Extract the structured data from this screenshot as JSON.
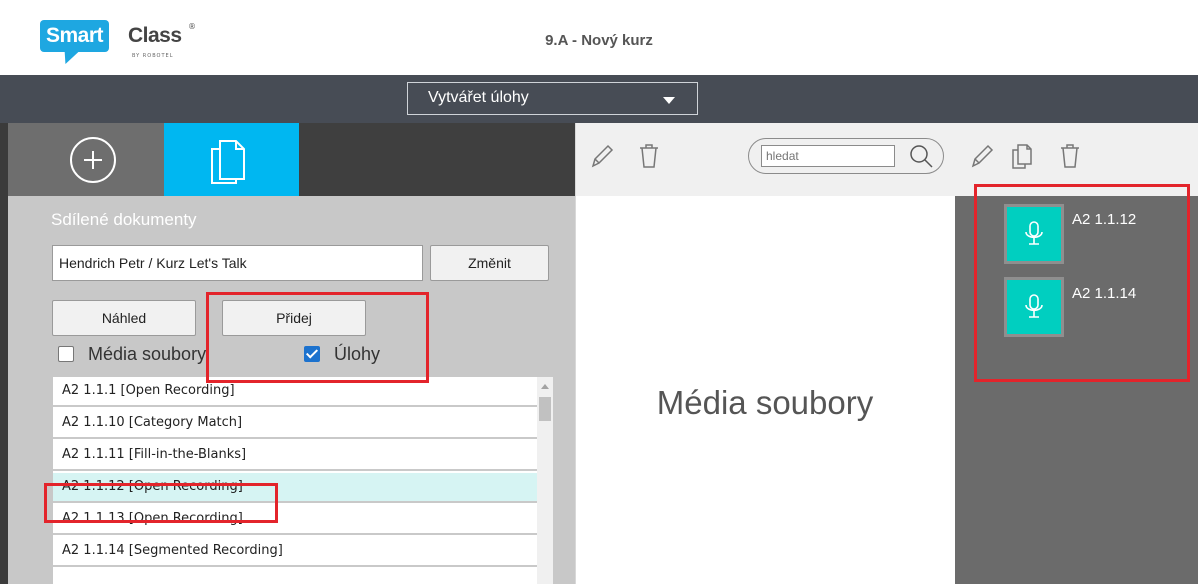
{
  "header": {
    "logo_smart": "Smart",
    "logo_class": "Class",
    "logo_reg": "®",
    "logo_by": "BY ROBOTEL",
    "course_title": "9.A - Nový kurz"
  },
  "mode_select": {
    "value": "Vytvářet úlohy"
  },
  "left_panel": {
    "title": "Sdílené dokumenty",
    "path_value": "Hendrich Petr / Kurz Let's Talk",
    "change_button": "Změnit",
    "preview_button": "Náhled",
    "add_button": "Přidej",
    "filters": [
      {
        "label": "Média soubory",
        "checked": false
      },
      {
        "label": "Úlohy",
        "checked": true
      }
    ],
    "items": [
      {
        "label": "A2 1.1.1 [Open Recording]"
      },
      {
        "label": "A2 1.1.10 [Category Match]"
      },
      {
        "label": "A2 1.1.11 [Fill-in-the-Blanks]"
      },
      {
        "label": "A2 1.1.12 [Open Recording]",
        "selected": true
      },
      {
        "label": "A2 1.1.13 [Open Recording]"
      },
      {
        "label": "A2 1.1.14 [Segmented Recording]"
      }
    ]
  },
  "middle_panel": {
    "empty_label": "Média soubory",
    "search_placeholder": "hledat"
  },
  "right_panel": {
    "tasks": [
      {
        "label": "A2 1.1.12",
        "icon": "microphone-icon"
      },
      {
        "label": "A2 1.1.14",
        "icon": "microphone-icon"
      }
    ]
  },
  "colors": {
    "accent_blue": "#00b7f1",
    "task_teal": "#00cfc0",
    "highlight_red": "#e3242b",
    "selected_row": "#d6f4f3"
  }
}
